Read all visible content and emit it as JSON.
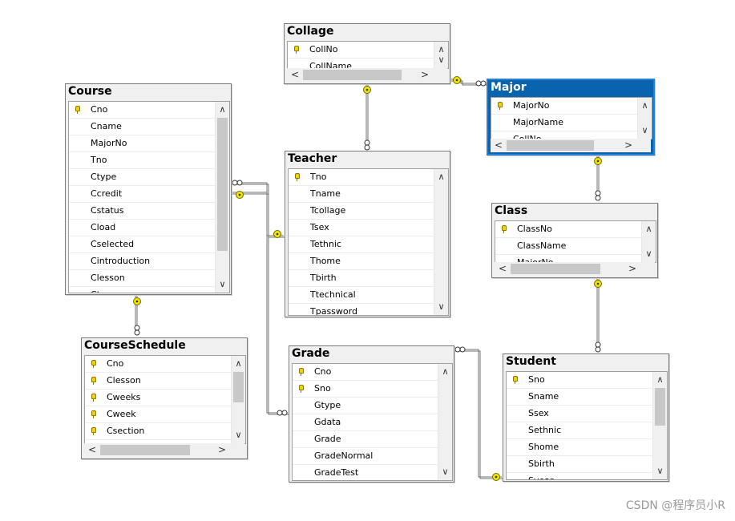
{
  "tables": {
    "collage": {
      "title": "Collage",
      "rows": [
        {
          "name": "CollNo",
          "pk": true
        },
        {
          "name": "CollName",
          "pk": false
        }
      ]
    },
    "major": {
      "title": "Major",
      "rows": [
        {
          "name": "MajorNo",
          "pk": true
        },
        {
          "name": "MajorName",
          "pk": false
        },
        {
          "name": "CollNo",
          "pk": false
        }
      ]
    },
    "course": {
      "title": "Course",
      "rows": [
        {
          "name": "Cno",
          "pk": true
        },
        {
          "name": "Cname",
          "pk": false
        },
        {
          "name": "MajorNo",
          "pk": false
        },
        {
          "name": "Tno",
          "pk": false
        },
        {
          "name": "Ctype",
          "pk": false
        },
        {
          "name": "Ccredit",
          "pk": false
        },
        {
          "name": "Cstatus",
          "pk": false
        },
        {
          "name": "Cload",
          "pk": false
        },
        {
          "name": "Cselected",
          "pk": false
        },
        {
          "name": "Cintroduction",
          "pk": false
        },
        {
          "name": "Clesson",
          "pk": false
        },
        {
          "name": "Cterm",
          "pk": false
        }
      ]
    },
    "teacher": {
      "title": "Teacher",
      "rows": [
        {
          "name": "Tno",
          "pk": true
        },
        {
          "name": "Tname",
          "pk": false
        },
        {
          "name": "Tcollage",
          "pk": false
        },
        {
          "name": "Tsex",
          "pk": false
        },
        {
          "name": "Tethnic",
          "pk": false
        },
        {
          "name": "Thome",
          "pk": false
        },
        {
          "name": "Tbirth",
          "pk": false
        },
        {
          "name": "Ttechnical",
          "pk": false
        },
        {
          "name": "Tpassword",
          "pk": false
        }
      ]
    },
    "class": {
      "title": "Class",
      "rows": [
        {
          "name": "ClassNo",
          "pk": true
        },
        {
          "name": "ClassName",
          "pk": false
        },
        {
          "name": "MajorNo",
          "pk": false
        }
      ]
    },
    "courseschedule": {
      "title": "CourseSchedule",
      "rows": [
        {
          "name": "Cno",
          "pk": true
        },
        {
          "name": "Clesson",
          "pk": true
        },
        {
          "name": "Cweeks",
          "pk": true
        },
        {
          "name": "Cweek",
          "pk": true
        },
        {
          "name": "Csection",
          "pk": true
        }
      ]
    },
    "grade": {
      "title": "Grade",
      "rows": [
        {
          "name": "Cno",
          "pk": true
        },
        {
          "name": "Sno",
          "pk": true
        },
        {
          "name": "Gtype",
          "pk": false
        },
        {
          "name": "Gdata",
          "pk": false
        },
        {
          "name": "Grade",
          "pk": false
        },
        {
          "name": "GradeNormal",
          "pk": false
        },
        {
          "name": "GradeTest",
          "pk": false
        }
      ]
    },
    "student": {
      "title": "Student",
      "rows": [
        {
          "name": "Sno",
          "pk": true
        },
        {
          "name": "Sname",
          "pk": false
        },
        {
          "name": "Ssex",
          "pk": false
        },
        {
          "name": "Sethnic",
          "pk": false
        },
        {
          "name": "Shome",
          "pk": false
        },
        {
          "name": "Sbirth",
          "pk": false
        },
        {
          "name": "Syear",
          "pk": false
        }
      ]
    }
  },
  "watermark": "CSDN @程序员小R",
  "colors": {
    "selected_title": "#0a64ad",
    "key_icon": "#f2d300",
    "connector": "#707070"
  },
  "icons": {
    "primary_key": "key-icon",
    "one_end": "key-connector-icon",
    "many_end": "infinity-connector-icon"
  }
}
